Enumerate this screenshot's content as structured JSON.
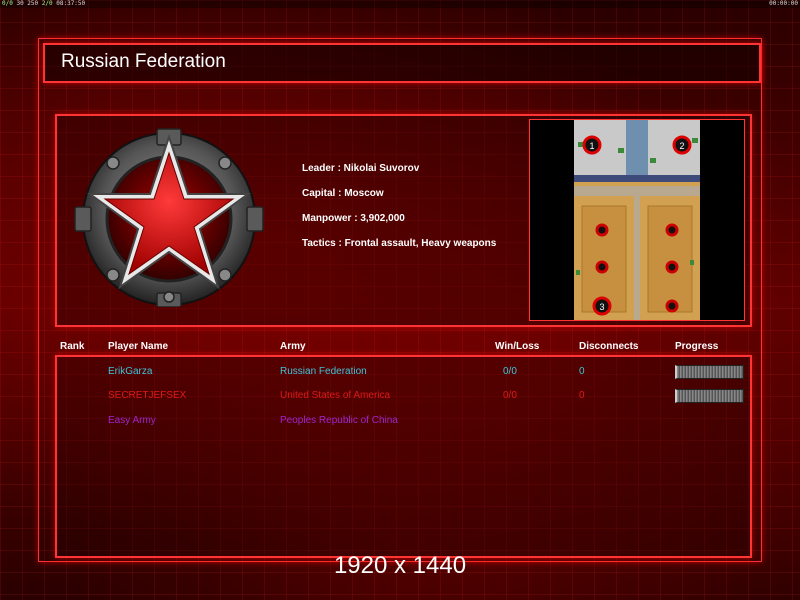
{
  "status_bar": {
    "left_a": "0/0",
    "left_b": "30 250",
    "left_c": "2/0",
    "left_time": "08:37:50",
    "right_time": "00:00:00"
  },
  "header": {
    "title": "Russian Federation"
  },
  "faction": {
    "emblem": "red-star-emblem",
    "details": [
      "Leader : Nikolai Suvorov",
      "Capital : Moscow",
      "Manpower : 3,902,000",
      "Tactics : Frontal assault, Heavy weapons"
    ]
  },
  "map": {
    "slots": [
      "1",
      "2",
      "3"
    ],
    "colors": {
      "sand": "#d1a050",
      "water": "#6f8fae",
      "road": "#b8a890",
      "urban": "#c9c9c9"
    }
  },
  "table": {
    "columns": [
      "Rank",
      "Player Name",
      "Army",
      "Win/Loss",
      "Disconnects",
      "Progress"
    ],
    "rows": [
      {
        "rank": "",
        "name": "ErikGarza",
        "army": "Russian Federation",
        "winloss": "0/0",
        "disconnects": "0",
        "progress": 1.0,
        "color": "#3fc3d8"
      },
      {
        "rank": "",
        "name": "SECRETJEFSEX",
        "army": "United States of America",
        "winloss": "0/0",
        "disconnects": "0",
        "progress": 1.0,
        "color": "#e01818"
      },
      {
        "rank": "",
        "name": "Easy Army",
        "army": "Peoples Republic of China",
        "winloss": "",
        "disconnects": "",
        "progress": null,
        "color": "#a024d0"
      }
    ]
  },
  "caption": "1920 x 1440",
  "colors": {
    "frame": "#ff3535",
    "background": "#3a0000"
  }
}
